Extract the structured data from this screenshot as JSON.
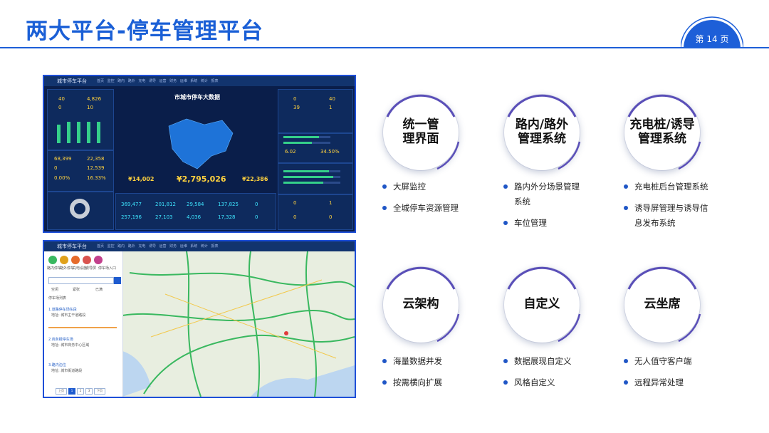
{
  "header": {
    "title": "两大平台-停车管理平台",
    "page_label": "第 14 页"
  },
  "screenshot_dashboard": {
    "brand": "城市停车平台",
    "menu": "首页 监控 路内 路外 充电 诱导 运营 财务 运维 系统 统计 报表",
    "title": "市城市停车大数据",
    "kpi_left": [
      "40",
      "4,826",
      "0",
      "10",
      "68,399",
      "22,358",
      "0",
      "12,539",
      "0.00%",
      "16.33%"
    ],
    "kpi_center": [
      "¥14,002",
      "¥2,795,026",
      "¥22,386"
    ],
    "kpi_bottom": [
      "369,477",
      "201,812",
      "29,584",
      "137,825",
      "0",
      "257,196",
      "27,103",
      "4,036",
      "17,328",
      "0"
    ],
    "kpi_right": [
      "0",
      "40",
      "39",
      "1",
      "6.02",
      "34.50%",
      "0",
      "1",
      "0",
      "0"
    ]
  },
  "screenshot_map": {
    "brand": "城市停车平台",
    "menu": "首页 监控 路内 路外 充电 诱导 运营 财务 运维 系统 统计 报表",
    "categories": [
      "路内停车",
      "路外停车",
      "充电设施",
      "诱导屏",
      "停车场入口"
    ],
    "legend": [
      "空闲",
      "紧张",
      "已满"
    ],
    "list_title": "停车场列表",
    "items": [
      {
        "name": "1.道路停车场东段",
        "addr": "地址: 城市主干道路段"
      },
      {
        "name": "2.商务楼停车场",
        "addr": "地址: 城市商务中心区域"
      },
      {
        "name": "3.路内泊位",
        "addr": "地址: 城市街道路段"
      }
    ],
    "pager": [
      "上页",
      "1",
      "2",
      "3",
      "下页"
    ]
  },
  "features": [
    {
      "title_lines": [
        "统一管",
        "理界面"
      ],
      "bullets": [
        "大屏监控",
        "全城停车资源管理"
      ]
    },
    {
      "title_lines": [
        "路内/路外",
        "管理系统"
      ],
      "bullets": [
        "路内外分场景管理",
        "系统",
        "车位管理"
      ]
    },
    {
      "title_lines": [
        "充电桩/诱导",
        "管理系统"
      ],
      "bullets": [
        "充电桩后台管理系统",
        "诱导屏管理与诱导信",
        "息发布系统"
      ]
    },
    {
      "title_lines": [
        "云架构"
      ],
      "bullets": [
        "海量数据并发",
        "按需横向扩展"
      ]
    },
    {
      "title_lines": [
        "自定义"
      ],
      "bullets": [
        "数据展现自定义",
        "风格自定义"
      ]
    },
    {
      "title_lines": [
        "云坐席"
      ],
      "bullets": [
        "无人值守客户端",
        "远程异常处理"
      ]
    }
  ],
  "colors": {
    "brand_blue": "#1a5fd6",
    "ring_purple": "#5a4fb8",
    "bullet_blue": "#1f56c6"
  }
}
